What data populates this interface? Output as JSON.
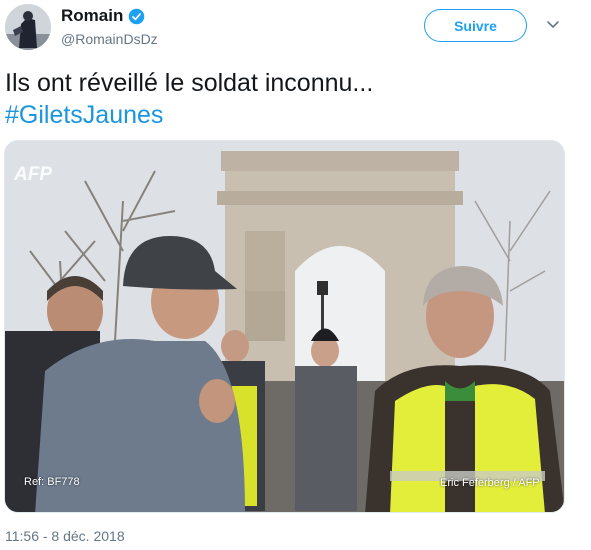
{
  "author": {
    "name": "Romain",
    "handle": "@RomainDsDz",
    "verified": true
  },
  "follow_button": {
    "label": "Suivre"
  },
  "tweet": {
    "text": "Ils ont réveillé le soldat inconnu...",
    "hashtag": "#GiletsJaunes"
  },
  "media": {
    "watermark": "AFP",
    "credit_left": "Ref: BF778",
    "credit_right": "Eric Feferberg / AFP"
  },
  "timestamp": "11:56 - 8 déc. 2018",
  "colors": {
    "link": "#1b95e0",
    "follow": "#1da1f2",
    "secondary_text": "#657786"
  }
}
